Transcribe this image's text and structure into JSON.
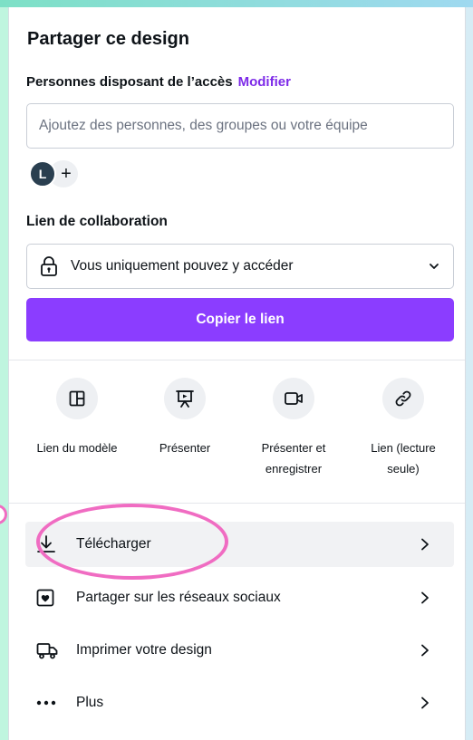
{
  "panel": {
    "title": "Partager ce design",
    "access_heading": "Personnes disposant de l’accès",
    "modify_link": "Modifier",
    "add_people_placeholder": "Ajoutez des personnes, des groupes ou votre équipe",
    "avatar_initial": "L",
    "add_avatar_symbol": "+",
    "collab_heading": "Lien de collaboration",
    "access_select_value": "Vous uniquement pouvez y accéder",
    "copy_button": "Copier le lien"
  },
  "share_options": [
    {
      "label_line1": "Lien du modèle",
      "label_line2": "",
      "icon": "template-layout-icon"
    },
    {
      "label_line1": "Présenter",
      "label_line2": "",
      "icon": "present-icon"
    },
    {
      "label_line1": "Présenter et",
      "label_line2": "enregistrer",
      "icon": "record-camera-icon"
    },
    {
      "label_line1": "Lien (lecture",
      "label_line2": "seule)",
      "icon": "link-icon"
    }
  ],
  "actions": [
    {
      "label": "Télécharger",
      "icon": "download-icon",
      "highlighted": true
    },
    {
      "label": "Partager sur les réseaux sociaux",
      "icon": "social-heart-icon"
    },
    {
      "label": "Imprimer votre design",
      "icon": "truck-icon"
    },
    {
      "label": "Plus",
      "icon": "more-dots-icon"
    }
  ],
  "colors": {
    "accent": "#8b3dff",
    "modify_link": "#7d2ae8",
    "annotation_oval": "#f06cc2",
    "background_mint": "#bff5df"
  }
}
